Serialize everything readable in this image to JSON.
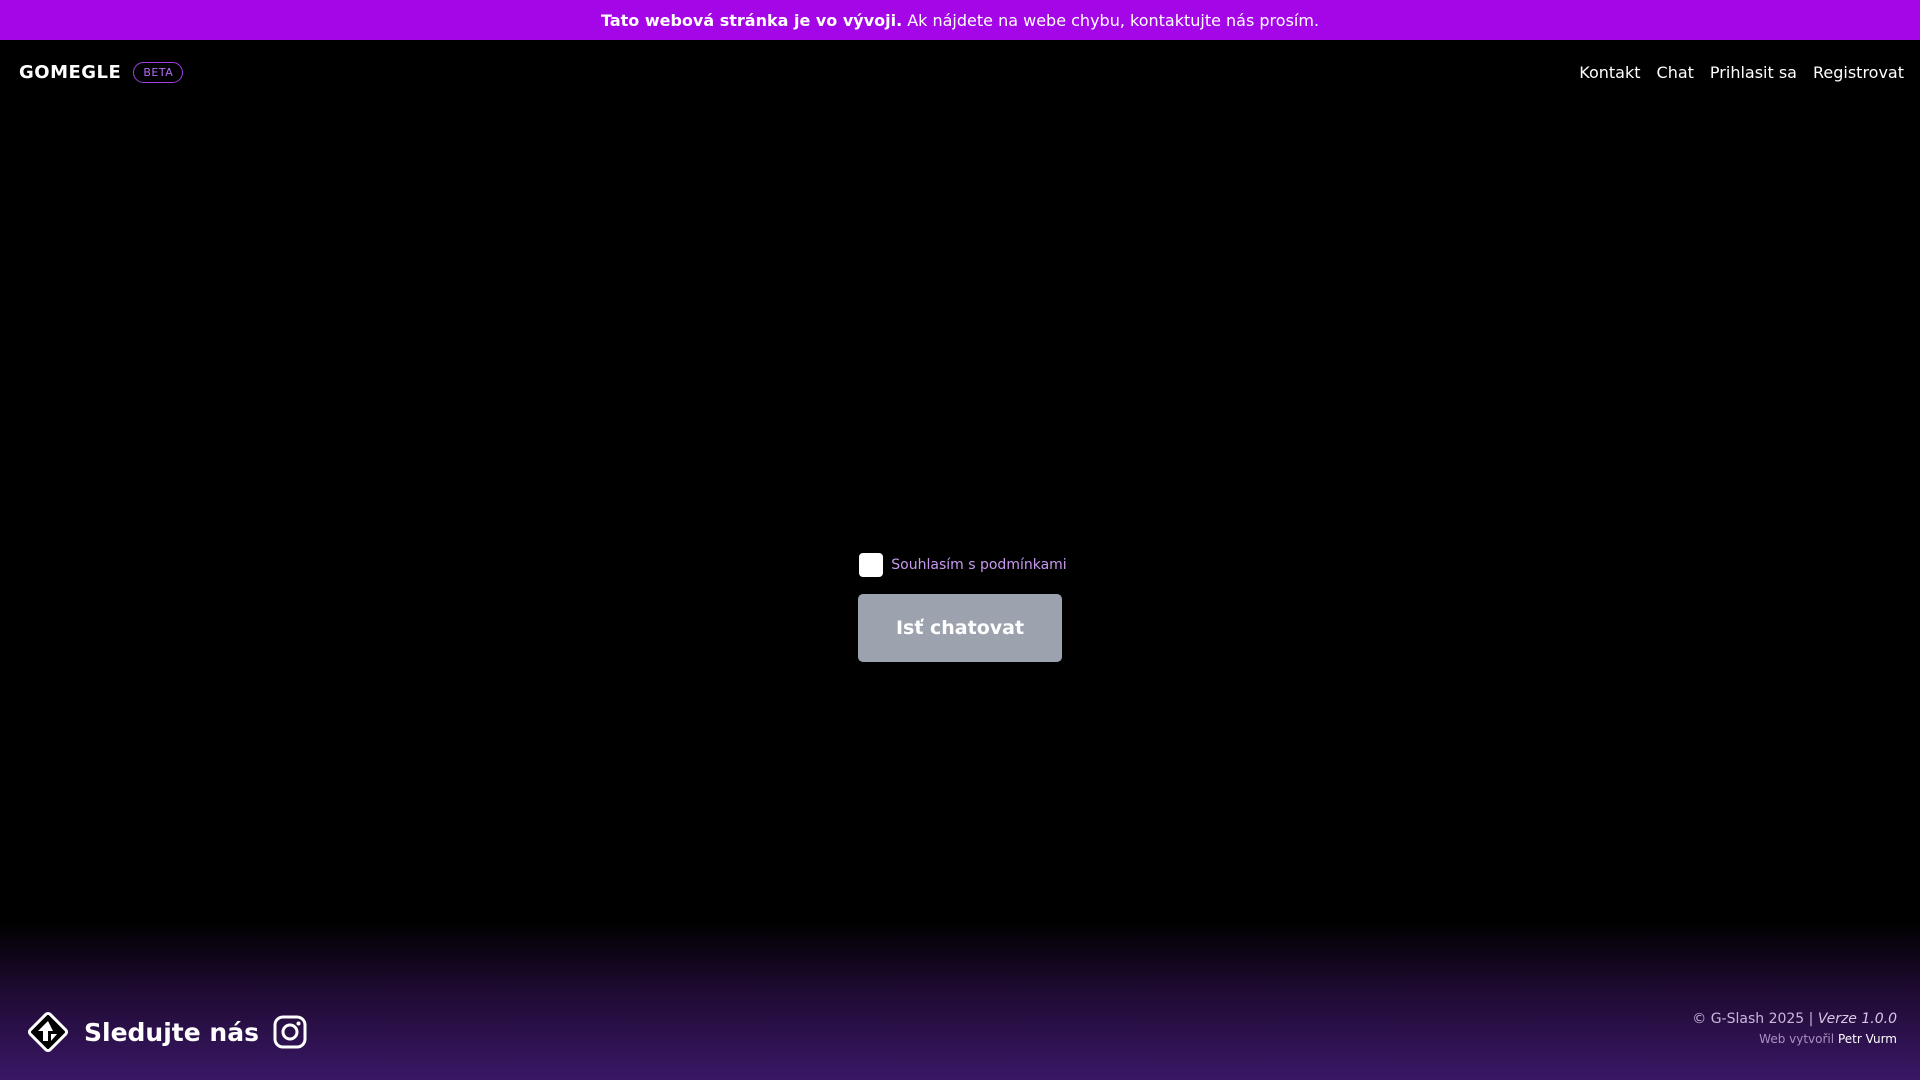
{
  "banner": {
    "strong_text": "Tato webová stránka je vo vývoji.",
    "text": "Ak nájdete na webe chybu, kontaktujte nás prosím."
  },
  "header": {
    "logo": "GOMEGLE",
    "badge": "BETA",
    "nav": [
      "Kontakt",
      "Chat",
      "Prihlasit sa",
      "Registrovat"
    ]
  },
  "main": {
    "agree_label": "Souhlasím s podmínkami",
    "agree_checked": false,
    "go_button_label": "Isť chatovat"
  },
  "footer": {
    "follow_label": "Sledujte nás",
    "copyright": "© G-Slash 2025 |",
    "version": "Verze 1.0.0",
    "made_by_prefix": "Web vytvořil",
    "author": "Petr Vurm"
  },
  "colors": {
    "banner": "#a506e8",
    "background": "#000000",
    "button_disabled": "#9ca3af",
    "accent_text": "#c79af0",
    "footer_gradient_end": "#3a1766"
  },
  "icons": {
    "gslash": "gslash-logo-icon",
    "instagram": "instagram-icon"
  }
}
